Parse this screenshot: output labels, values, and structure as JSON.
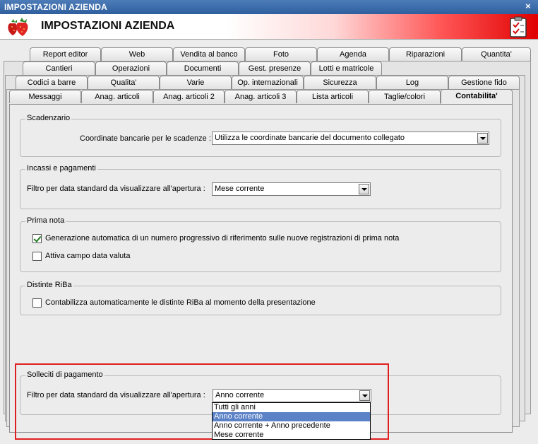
{
  "window": {
    "title": "IMPOSTAZIONI AZIENDA",
    "close_glyph": "×"
  },
  "header": {
    "title": "IMPOSTAZIONI AZIENDA",
    "logo_icon": "strawberry-icon",
    "action_icon": "clipboard-check-icon"
  },
  "tabs": {
    "row1": [
      "Report editor",
      "Web",
      "Vendita al banco",
      "Foto",
      "Agenda",
      "Riparazioni",
      "Quantita'"
    ],
    "row2": [
      "Cantieri",
      "Operazioni",
      "Documenti",
      "Gest. presenze",
      "Lotti e matricole"
    ],
    "row3": [
      "Codici a barre",
      "Qualita'",
      "Varie",
      "Op. internazionali",
      "Sicurezza",
      "Log",
      "Gestione fido"
    ],
    "row4": [
      "Messaggi",
      "Anag. articoli",
      "Anag. articoli 2",
      "Anag. articoli 3",
      "Lista articoli",
      "Taglie/colori",
      "Contabilita'"
    ],
    "active": "Contabilita'"
  },
  "scadenzario": {
    "title": "Scadenzario",
    "coord_label": "Coordinate bancarie per le scadenze :",
    "coord_value": "Utilizza le coordinate bancarie del documento collegato"
  },
  "incassi": {
    "title": "Incassi e pagamenti",
    "filter_label": "Filtro per data standard da visualizzare all'apertura :",
    "filter_value": "Mese corrente"
  },
  "prima_nota": {
    "title": "Prima nota",
    "check1": {
      "label": "Generazione automatica di un numero progressivo di riferimento sulle nuove registrazioni di prima nota",
      "checked": true
    },
    "check2": {
      "label": "Attiva campo data valuta",
      "checked": false
    }
  },
  "distinte": {
    "title": "Distinte RiBa",
    "check1": {
      "label": "Contabilizza automaticamente le distinte RiBa al momento della presentazione",
      "checked": false
    }
  },
  "solleciti": {
    "title": "Solleciti di pagamento",
    "filter_label": "Filtro per data standard da visualizzare all'apertura :",
    "filter_value": "Anno corrente",
    "options": [
      "Tutti gli anni",
      "Anno corrente",
      "Anno corrente + Anno precedente",
      "Mese corrente"
    ],
    "selected_index": 1
  },
  "colors": {
    "highlight": "#e02020",
    "selection": "#5b82c6",
    "titlebar": "#2f5f9e"
  }
}
